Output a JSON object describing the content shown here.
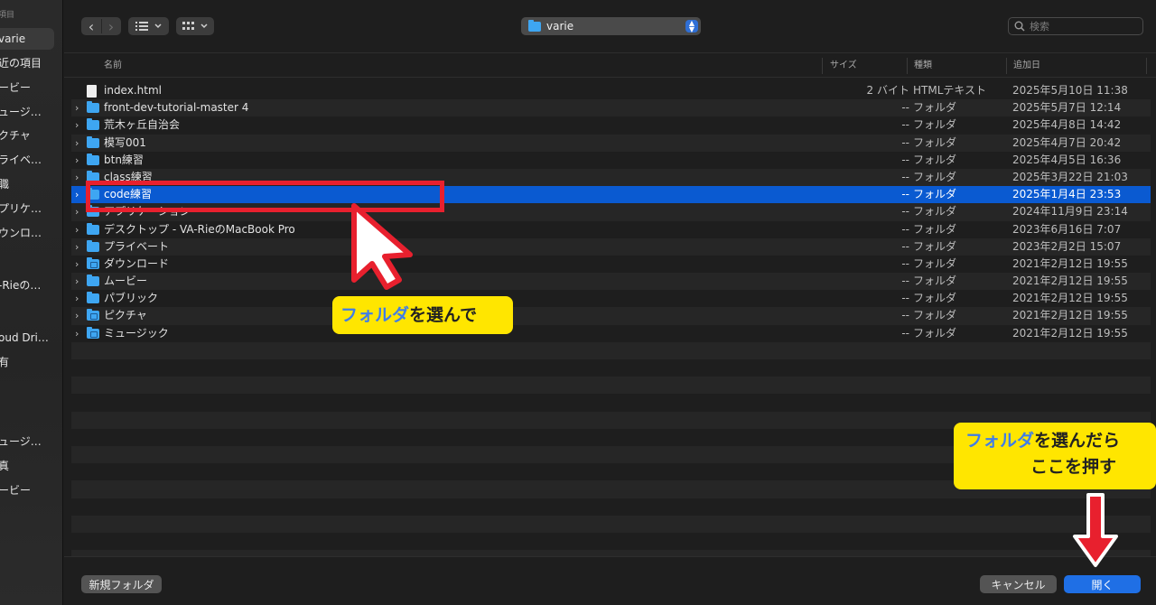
{
  "sidebar": {
    "section_label": "項目",
    "items": [
      "varie",
      "近の項目",
      "ービー",
      "ュージ…",
      "クチャ",
      "ライベ…",
      "職",
      "プリケ…",
      "ウンロ…",
      "-Rieの…",
      "oud Dri…",
      "有",
      "ュージ…",
      "真",
      "ービー"
    ],
    "selected_index": 0
  },
  "toolbar": {
    "back_icon": "‹",
    "forward_icon": "›",
    "path_label": "varie",
    "search_placeholder": "検索"
  },
  "columns": {
    "name": "名前",
    "size": "サイズ",
    "kind": "種類",
    "date_added": "追加日"
  },
  "files": [
    {
      "name": "index.html",
      "size": "2 バイト",
      "kind": "HTMLテキスト",
      "date": "2025年5月10日 11:38",
      "type": "file"
    },
    {
      "name": "front-dev-tutorial-master 4",
      "size": "--",
      "kind": "フォルダ",
      "date": "2025年5月7日 12:14",
      "type": "folder"
    },
    {
      "name": "荒木ヶ丘自治会",
      "size": "--",
      "kind": "フォルダ",
      "date": "2025年4月8日 14:42",
      "type": "folder"
    },
    {
      "name": "模写001",
      "size": "--",
      "kind": "フォルダ",
      "date": "2025年4月7日 20:42",
      "type": "folder"
    },
    {
      "name": "btn練習",
      "size": "--",
      "kind": "フォルダ",
      "date": "2025年4月5日 16:36",
      "type": "folder"
    },
    {
      "name": "class練習",
      "size": "--",
      "kind": "フォルダ",
      "date": "2025年3月22日 21:03",
      "type": "folder"
    },
    {
      "name": "code練習",
      "size": "--",
      "kind": "フォルダ",
      "date": "2025年1月4日 23:53",
      "type": "folder",
      "selected": true
    },
    {
      "name": "アプリケーション",
      "size": "--",
      "kind": "フォルダ",
      "date": "2024年11月9日 23:14",
      "type": "folder"
    },
    {
      "name": "デスクトップ - VA-RieのMacBook Pro",
      "size": "--",
      "kind": "フォルダ",
      "date": "2023年6月16日 7:07",
      "type": "folder"
    },
    {
      "name": "プライベート",
      "size": "--",
      "kind": "フォルダ",
      "date": "2023年2月2日 15:07",
      "type": "folder"
    },
    {
      "name": "ダウンロード",
      "size": "--",
      "kind": "フォルダ",
      "date": "2021年2月12日 19:55",
      "type": "special-folder"
    },
    {
      "name": "ムービー",
      "size": "--",
      "kind": "フォルダ",
      "date": "2021年2月12日 19:55",
      "type": "folder"
    },
    {
      "name": "パブリック",
      "size": "--",
      "kind": "フォルダ",
      "date": "2021年2月12日 19:55",
      "type": "folder"
    },
    {
      "name": "ピクチャ",
      "size": "--",
      "kind": "フォルダ",
      "date": "2021年2月12日 19:55",
      "type": "special-folder"
    },
    {
      "name": "ミュージック",
      "size": "--",
      "kind": "フォルダ",
      "date": "2021年2月12日 19:55",
      "type": "special-folder"
    }
  ],
  "bottom": {
    "new_folder": "新規フォルダ",
    "cancel": "キャンセル",
    "open": "開く"
  },
  "annotations": {
    "callout_1_blue": "フォルダ",
    "callout_1_rest": "を選んで",
    "callout_2_blue": "フォルダ",
    "callout_2_rest": "を選んだら",
    "callout_2_line2": "ここを押す"
  },
  "colors": {
    "selection": "#0a5ad1",
    "folder": "#3ea6f2",
    "highlight_red": "#e8202e",
    "callout_yellow": "#ffe600",
    "primary_button": "#1f6fe5"
  }
}
